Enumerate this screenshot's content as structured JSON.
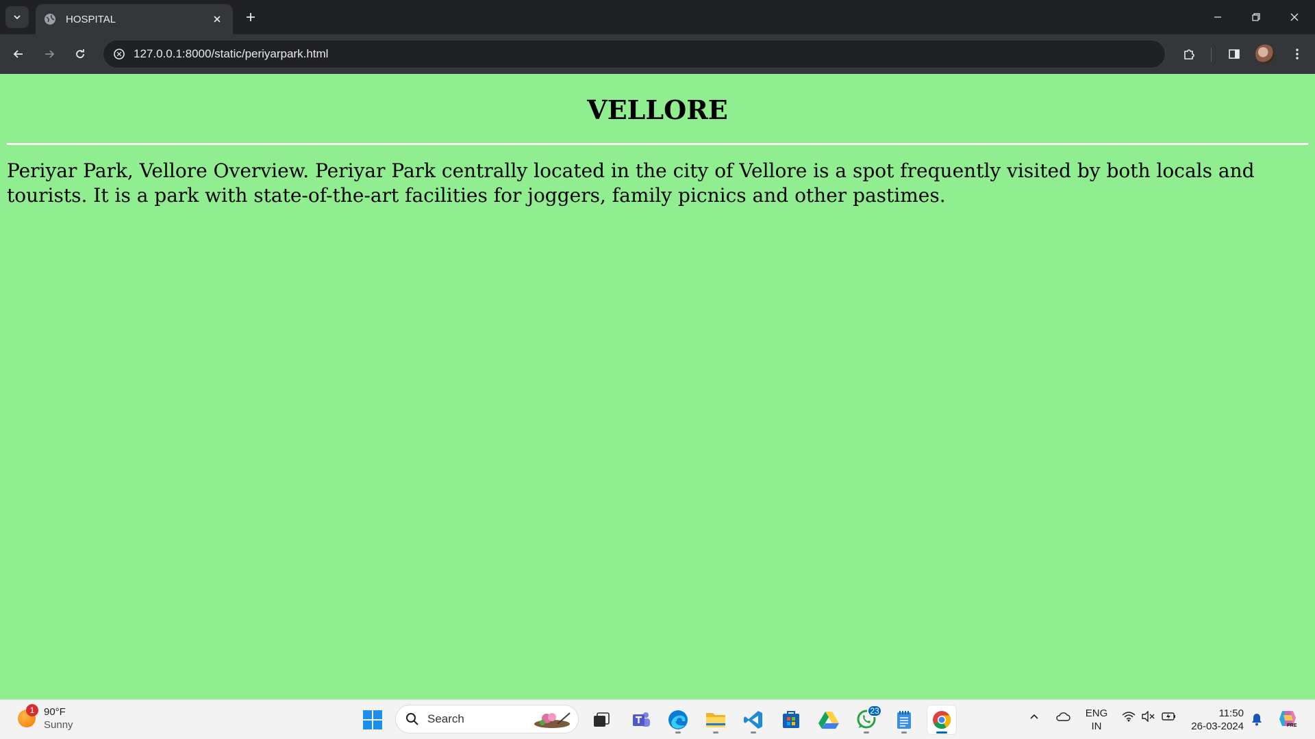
{
  "browser": {
    "tab": {
      "title": "HOSPITAL"
    },
    "address": {
      "url": "127.0.0.1:8000/static/periyarpark.html"
    }
  },
  "page": {
    "background": "#90ee90",
    "heading": "VELLORE",
    "paragraph": "Periyar Park, Vellore Overview. Periyar Park centrally located in the city of Vellore is a spot frequently visited by both locals and tourists. It is a park with state-of-the-art facilities for joggers, family picnics and other pastimes."
  },
  "taskbar": {
    "weather": {
      "temp": "90°F",
      "condition": "Sunny",
      "badge": "1"
    },
    "search_label": "Search",
    "apps": [
      "start-icon",
      "search",
      "task-view-icon",
      "teams-icon",
      "edge-icon",
      "file-explorer-icon",
      "vscode-icon",
      "store-icon",
      "drive-icon",
      "whatsapp-icon",
      "notepad-icon",
      "chrome-icon"
    ],
    "whatsapp_badge": "23",
    "language": {
      "line1": "ENG",
      "line2": "IN"
    },
    "clock": {
      "time": "11:50",
      "date": "26-03-2024"
    }
  }
}
